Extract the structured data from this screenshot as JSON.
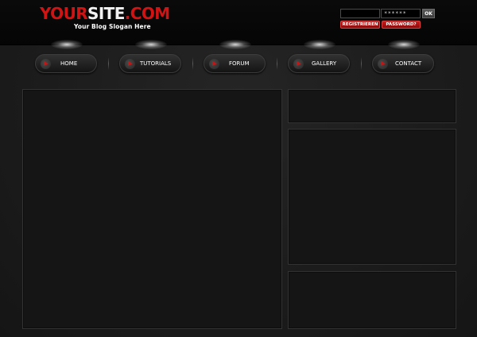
{
  "header": {
    "logo": {
      "part1": "YOUR",
      "part2": "SITE",
      "part3": ".COM"
    },
    "slogan": "Your Blog Slogan Here",
    "login": {
      "username_value": "",
      "password_value": "******",
      "ok_label": "OK",
      "register_label": "REGISTRIEREN",
      "forgot_password_label": "PASSWORD?"
    }
  },
  "nav": {
    "items": [
      {
        "label": "HOME",
        "icon": "play-arrow-icon"
      },
      {
        "label": "TUTORIALS",
        "icon": "play-arrow-icon"
      },
      {
        "label": "FORUM",
        "icon": "play-arrow-icon"
      },
      {
        "label": "GALLERY",
        "icon": "play-arrow-icon"
      },
      {
        "label": "CONTACT",
        "icon": "play-arrow-icon"
      }
    ]
  },
  "colors": {
    "accent_red": "#d11313",
    "background": "#1b1b1b",
    "panel": "#151515"
  }
}
